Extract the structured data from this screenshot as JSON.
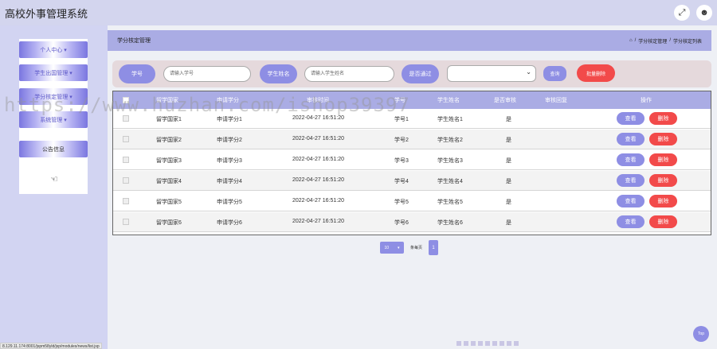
{
  "app": {
    "title": "高校外事管理系统"
  },
  "topbar": {
    "icons": [
      "fullscreen-icon",
      "user-icon"
    ]
  },
  "sidebar": {
    "items": [
      {
        "label": "个人中心",
        "arrow": "▾"
      },
      {
        "label": "学生出国管理",
        "arrow": "▾"
      },
      {
        "label": "学分核定管理",
        "arrow": "▾"
      },
      {
        "label": "系统管理",
        "arrow": "▾"
      },
      {
        "label": "公告信息",
        "arrow": ""
      }
    ]
  },
  "header": {
    "title": "学分核定管理",
    "breadcrumb": {
      "home": "⌂",
      "sep1": "/",
      "item1": "学分核定管理",
      "sep2": "/",
      "item2": "学分核定列表"
    }
  },
  "search": {
    "student_id_label": "学号",
    "student_id_placeholder": "请输入学号",
    "student_name_label": "学生姓名",
    "student_name_placeholder": "请输入学生姓名",
    "passed_label": "是否通过",
    "query_button": "查询",
    "batch_delete_button": "批量删除"
  },
  "table": {
    "columns": [
      "留学国家",
      "申请学分",
      "审核时间",
      "学号",
      "学生姓名",
      "是否审核",
      "审核回复",
      "操作"
    ],
    "rows": [
      {
        "country": "留学国家1",
        "credits": "申请学分1",
        "time": "2022-04-27 16:51:20",
        "sid": "学号1",
        "name": "学生姓名1",
        "reviewed": "是"
      },
      {
        "country": "留学国家2",
        "credits": "申请学分2",
        "time": "2022-04-27 16:51:20",
        "sid": "学号2",
        "name": "学生姓名2",
        "reviewed": "是"
      },
      {
        "country": "留学国家3",
        "credits": "申请学分3",
        "time": "2022-04-27 16:51:20",
        "sid": "学号3",
        "name": "学生姓名3",
        "reviewed": "是"
      },
      {
        "country": "留学国家4",
        "credits": "申请学分4",
        "time": "2022-04-27 16:51:20",
        "sid": "学号4",
        "name": "学生姓名4",
        "reviewed": "是"
      },
      {
        "country": "留学国家5",
        "credits": "申请学分5",
        "time": "2022-04-27 16:51:20",
        "sid": "学号5",
        "name": "学生姓名5",
        "reviewed": "是"
      },
      {
        "country": "留学国家6",
        "credits": "申请学分6",
        "time": "2022-04-27 16:51:20",
        "sid": "学号6",
        "name": "学生姓名6",
        "reviewed": "是"
      }
    ],
    "view_button": "查看",
    "delete_button": "删除"
  },
  "pager": {
    "page_size": "10",
    "page_size_arrow": "▾",
    "per_page_label": "条每页",
    "current_page": "1"
  },
  "watermark": "https://www.huzhan.com/ishop39397",
  "status_url": "8.129.11.174:8001/jspm58yld/jsp/modules/news/list.jsp",
  "back_to_top": "Top",
  "colors": {
    "accent": "#8e8ee4",
    "danger": "#f24a4a",
    "header": "#aaace4",
    "sidebar": "#d2d4f2"
  }
}
